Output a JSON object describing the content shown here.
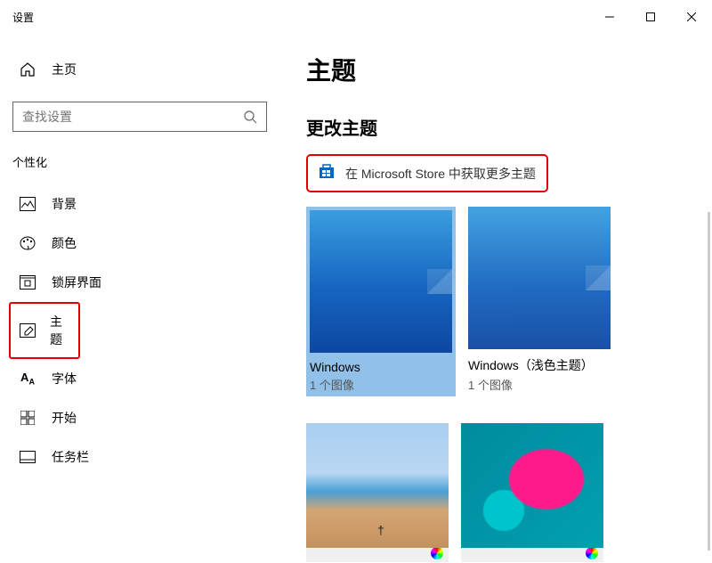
{
  "window": {
    "title": "设置"
  },
  "sidebar": {
    "home_label": "主页",
    "search_placeholder": "查找设置",
    "section_title": "个性化",
    "items": [
      {
        "label": "背景",
        "icon": "picture"
      },
      {
        "label": "颜色",
        "icon": "palette"
      },
      {
        "label": "锁屏界面",
        "icon": "lockscreen"
      },
      {
        "label": "主题",
        "icon": "themes",
        "selected": true
      },
      {
        "label": "字体",
        "icon": "fonts"
      },
      {
        "label": "开始",
        "icon": "start"
      },
      {
        "label": "任务栏",
        "icon": "taskbar"
      }
    ]
  },
  "main": {
    "title": "主题",
    "subtitle": "更改主题",
    "store_link": "在 Microsoft Store 中获取更多主题",
    "themes": [
      {
        "name": "Windows",
        "count": "1 个图像",
        "selected": true,
        "kind": "default"
      },
      {
        "name": "Windows（浅色主题）",
        "count": "1 个图像",
        "selected": false,
        "kind": "light"
      },
      {
        "name": "",
        "count": "",
        "selected": false,
        "kind": "beach"
      },
      {
        "name": "",
        "count": "",
        "selected": false,
        "kind": "flower"
      }
    ]
  }
}
